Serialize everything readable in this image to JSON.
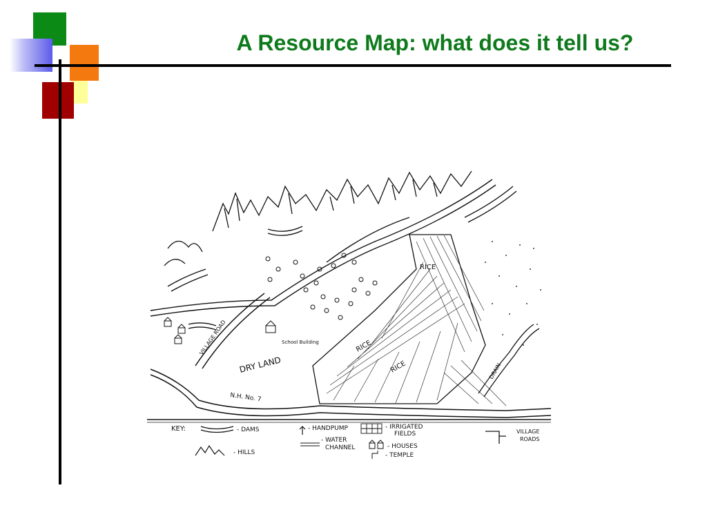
{
  "slide": {
    "title": "A Resource Map: what does it tell us?"
  },
  "map": {
    "labels": {
      "dry_land": "DRY LAND",
      "rice_1": "RICE",
      "rice_2": "RICE",
      "rice_3": "RICE",
      "road": "N.H. No. 7",
      "village_road": "VILLAGE ROAD",
      "drainage": "DRAIN",
      "school": "School Building"
    },
    "key": {
      "heading": "KEY:",
      "dams": "- DAMS",
      "hills": "- HILLS",
      "handpump": "- HANDPUMP",
      "water_channel_1": "- WATER",
      "water_channel_2": "CHANNEL",
      "irrigated_1": "- IRRIGATED",
      "irrigated_2": "FIELDS",
      "houses": "- HOUSES",
      "temple": "- TEMPLE",
      "village_roads_1": "VILLAGE",
      "village_roads_2": "ROADS"
    }
  },
  "colors": {
    "title": "#0e7a1c",
    "green": "#0b8a16",
    "orange": "#f47a10",
    "red": "#a00000",
    "yellow": "#ffff9a"
  }
}
